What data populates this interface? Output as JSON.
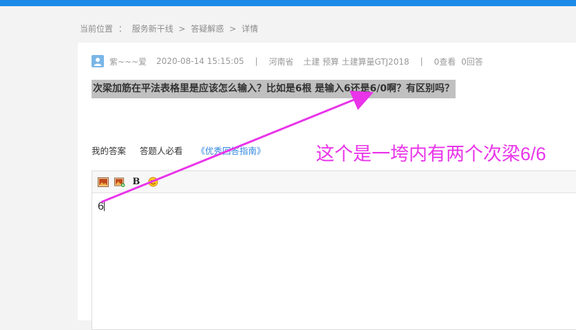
{
  "breadcrumb": {
    "label": "当前位置",
    "colon": "：",
    "items": [
      "服务新干线",
      "答疑解惑",
      "详情"
    ],
    "separator": ">"
  },
  "question": {
    "author": "紫~~~爱",
    "datetime": "2020-08-14 15:15:05",
    "divider": "|",
    "region": "河南省",
    "tags": "土建 预算 土建算量GTJ2018",
    "views": "0查看",
    "answers": "0回答",
    "title": "次梁加筋在平法表格里是应该怎么输入？比如是6根 是输入6还是6/0啊？有区别吗？"
  },
  "answer_tabs": {
    "my_answer": "我的答案",
    "must_read": "答题人必看",
    "guide_link": "《优秀回答指南》"
  },
  "editor": {
    "toolbar": [
      "image-icon",
      "insert-image-icon",
      "bold-icon",
      "emoji-icon"
    ],
    "bold_label": "B",
    "content": "6"
  },
  "annotation": {
    "text": "这个是一垮内有两个次梁6/6",
    "color": "#e934e9"
  },
  "colors": {
    "topbar": "#1e8ae8",
    "highlight": "#c0c0c0",
    "link": "#2e86de"
  }
}
